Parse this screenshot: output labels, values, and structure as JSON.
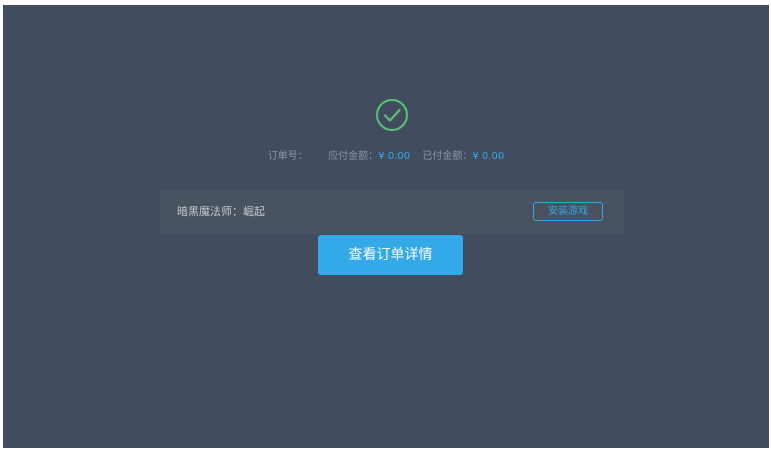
{
  "status": {
    "icon": "check-circle-icon",
    "icon_color": "#5cc07a"
  },
  "order": {
    "order_no_label": "订单号：",
    "order_no_value": "",
    "payable_label": "应付金额：",
    "payable_value": "¥ 0.00",
    "paid_label": "已付金额：",
    "paid_value": "¥ 0.00"
  },
  "game": {
    "name": "暗黑魔法师：崛起",
    "install_label": "安装游戏"
  },
  "actions": {
    "view_order_label": "查看订单详情"
  },
  "colors": {
    "panel_bg": "#414d5e",
    "row_bg": "#49525f",
    "accent": "#34a7e3",
    "button_bg": "#33a9e7"
  }
}
